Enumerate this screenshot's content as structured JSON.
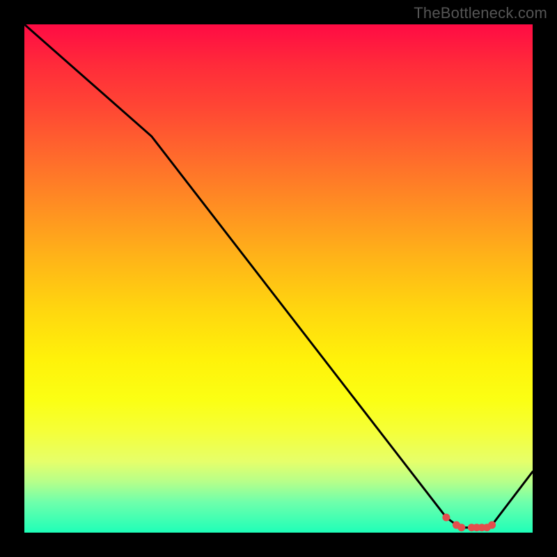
{
  "watermark": "TheBottleneck.com",
  "chart_data": {
    "type": "line",
    "title": "",
    "xlabel": "",
    "ylabel": "",
    "xlim": [
      0,
      100
    ],
    "ylim": [
      0,
      100
    ],
    "grid": false,
    "legend": false,
    "series": [
      {
        "name": "curve",
        "x": [
          0,
          25,
          83,
          85,
          86,
          88,
          89,
          90,
          91,
          92,
          100
        ],
        "values": [
          100,
          78,
          3,
          1.5,
          1,
          1,
          1,
          1,
          1,
          1.5,
          12
        ]
      }
    ],
    "markers": {
      "name": "flat-valley-points",
      "color": "#e34d4d",
      "x": [
        83,
        85,
        86,
        88,
        89,
        90,
        91,
        92
      ],
      "values": [
        3,
        1.5,
        1,
        1,
        1,
        1,
        1,
        1.5
      ]
    }
  }
}
